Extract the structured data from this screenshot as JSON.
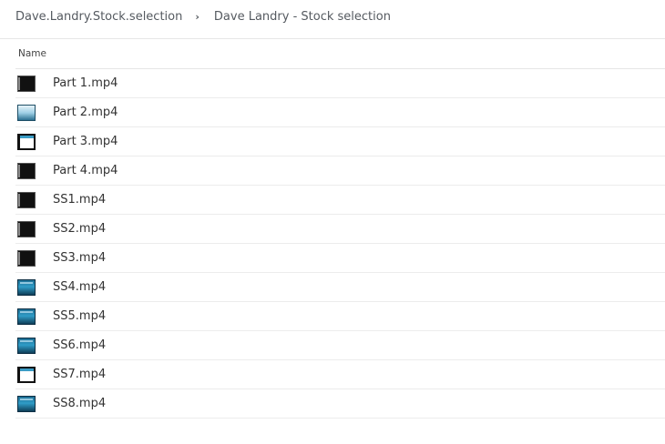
{
  "breadcrumb": {
    "root": "Dave.Landry.Stock.selection",
    "separator": "›",
    "current": "Dave Landry - Stock selection"
  },
  "list": {
    "column_name": "Name",
    "files": [
      {
        "name": "Part 1.mp4",
        "thumb": "dark"
      },
      {
        "name": "Part 2.mp4",
        "thumb": "light"
      },
      {
        "name": "Part 3.mp4",
        "thumb": "frame"
      },
      {
        "name": "Part 4.mp4",
        "thumb": "dark"
      },
      {
        "name": "SS1.mp4",
        "thumb": "dark"
      },
      {
        "name": "SS2.mp4",
        "thumb": "dark"
      },
      {
        "name": "SS3.mp4",
        "thumb": "dark"
      },
      {
        "name": "SS4.mp4",
        "thumb": "blue"
      },
      {
        "name": "SS5.mp4",
        "thumb": "blue"
      },
      {
        "name": "SS6.mp4",
        "thumb": "blue"
      },
      {
        "name": "SS7.mp4",
        "thumb": "frame"
      },
      {
        "name": "SS8.mp4",
        "thumb": "blue"
      }
    ]
  }
}
